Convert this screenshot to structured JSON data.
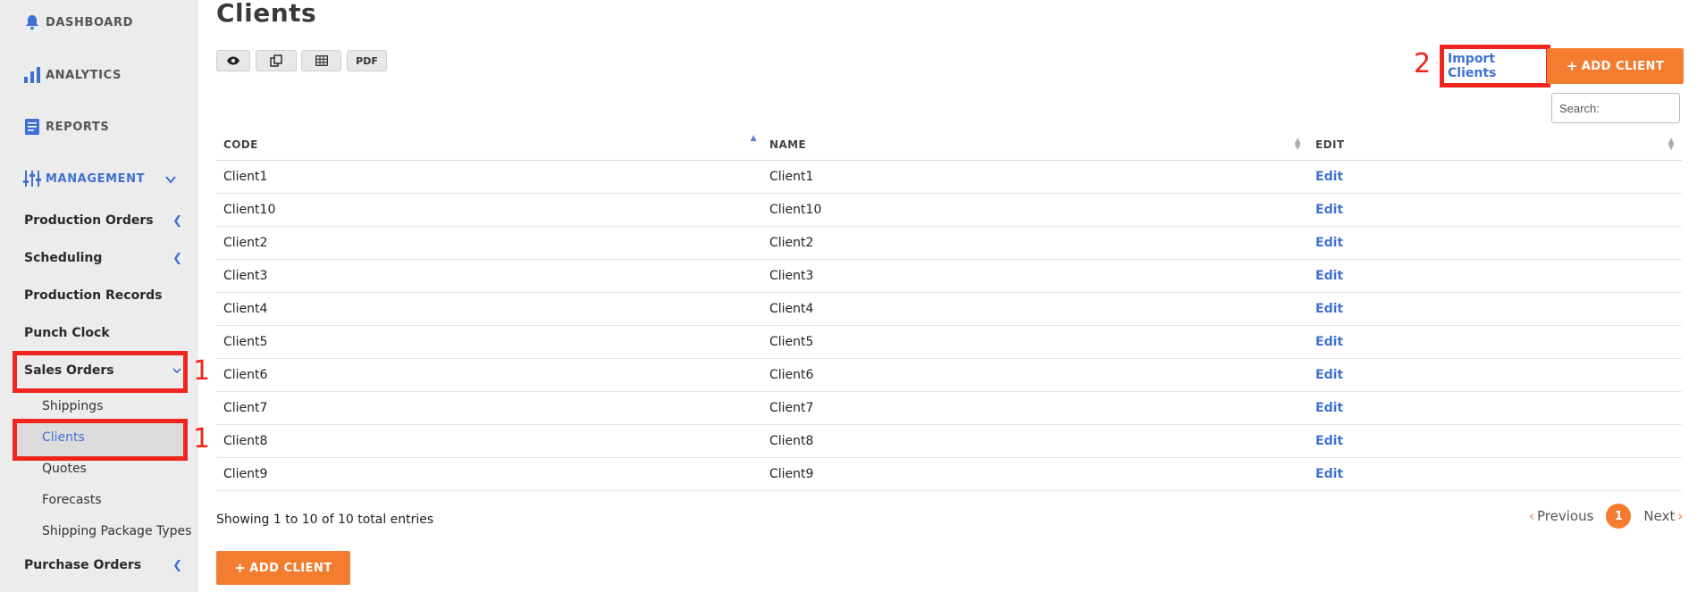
{
  "sidebar": {
    "top": [
      {
        "label": "DASHBOARD",
        "icon": "bell-icon"
      },
      {
        "label": "ANALYTICS",
        "icon": "bar-chart-icon"
      },
      {
        "label": "REPORTS",
        "icon": "document-icon"
      },
      {
        "label": "MANAGEMENT",
        "icon": "sliders-icon"
      }
    ],
    "items": [
      {
        "label": "Production Orders"
      },
      {
        "label": "Scheduling"
      },
      {
        "label": "Production Records"
      },
      {
        "label": "Punch Clock"
      },
      {
        "label": "Sales Orders"
      },
      {
        "label": "Purchase Orders"
      }
    ],
    "sub_items": [
      "Shippings",
      "Clients",
      "Quotes",
      "Forecasts",
      "Shipping Package Types"
    ]
  },
  "annotations": {
    "step1": "1",
    "step2": "2"
  },
  "page": {
    "title": "Clients"
  },
  "toolbar": {
    "pdf_label": "PDF"
  },
  "actions": {
    "import_label": "Import Clients",
    "add_label": "ADD CLIENT"
  },
  "search": {
    "placeholder": "Search:"
  },
  "table": {
    "columns": [
      "CODE",
      "NAME",
      "EDIT"
    ],
    "rows": [
      [
        "Client1",
        "Client1",
        "Edit"
      ],
      [
        "Client10",
        "Client10",
        "Edit"
      ],
      [
        "Client2",
        "Client2",
        "Edit"
      ],
      [
        "Client3",
        "Client3",
        "Edit"
      ],
      [
        "Client4",
        "Client4",
        "Edit"
      ],
      [
        "Client5",
        "Client5",
        "Edit"
      ],
      [
        "Client6",
        "Client6",
        "Edit"
      ],
      [
        "Client7",
        "Client7",
        "Edit"
      ],
      [
        "Client8",
        "Client8",
        "Edit"
      ],
      [
        "Client9",
        "Client9",
        "Edit"
      ]
    ]
  },
  "footer": {
    "info": "Showing 1 to 10 of 10 total entries"
  },
  "pagination": {
    "previous": "Previous",
    "page": "1",
    "next": "Next"
  },
  "colors": {
    "accent": "#3f70d4",
    "orange": "#f47c2f",
    "highlight": "#f0251e"
  }
}
